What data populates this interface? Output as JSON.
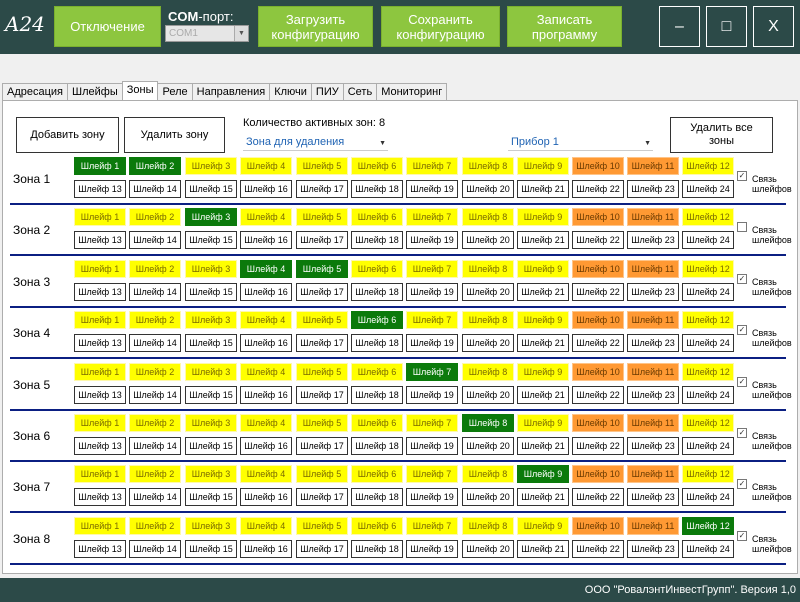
{
  "app": {
    "logo": "A24"
  },
  "toolbar": {
    "disconnect": "Отключение",
    "com_bold": "COM",
    "com_rest": "-порт:",
    "com_value": "COM1",
    "load": "Загрузить\nконфигурацию",
    "save": "Сохранить\nконфигурацию",
    "write": "Записать\nпрограмму",
    "minimize": "–",
    "maximize": "□",
    "close": "X"
  },
  "tabs": [
    "Адресация",
    "Шлейфы",
    "Зоны",
    "Реле",
    "Направления",
    "Ключи",
    "ПИУ",
    "Сеть",
    "Мониторинг"
  ],
  "active_tab": "Зоны",
  "zones_panel": {
    "add_button": "Добавить зону",
    "delete_button": "Удалить зону",
    "active_count": "Количество активных зон: 8",
    "zone_for_delete": "Зона для удаления",
    "device": "Прибор 1",
    "delete_all_button": "Удалить все\nзоны",
    "link_label": "Связь\nшлейфов"
  },
  "loops": [
    "Шлейф 1",
    "Шлейф 2",
    "Шлейф 3",
    "Шлейф 4",
    "Шлейф 5",
    "Шлейф 6",
    "Шлейф 7",
    "Шлейф 8",
    "Шлейф 9",
    "Шлейф 10",
    "Шлейф 11",
    "Шлейф 12",
    "Шлейф 13",
    "Шлейф 14",
    "Шлейф 15",
    "Шлейф 16",
    "Шлейф 17",
    "Шлейф 18",
    "Шлейф 19",
    "Шлейф 20",
    "Шлейф 21",
    "Шлейф 22",
    "Шлейф 23",
    "Шлейф 24"
  ],
  "zones": [
    {
      "name": "Зона 1",
      "selected": [
        1,
        2
      ],
      "link": true
    },
    {
      "name": "Зона 2",
      "selected": [
        3
      ],
      "link": false
    },
    {
      "name": "Зона 3",
      "selected": [
        4,
        5
      ],
      "link": true
    },
    {
      "name": "Зона 4",
      "selected": [
        6
      ],
      "link": true
    },
    {
      "name": "Зона 5",
      "selected": [
        7
      ],
      "link": true
    },
    {
      "name": "Зона 6",
      "selected": [
        8
      ],
      "link": true
    },
    {
      "name": "Зона 7",
      "selected": [
        9
      ],
      "link": true
    },
    {
      "name": "Зона 8",
      "selected": [
        12
      ],
      "link": true
    }
  ],
  "colors": {
    "topbar": "#2c4a48",
    "button_green": "#8dc63f",
    "loop_yellow": "#ffff00",
    "loop_orange": "#ff9933",
    "loop_selected": "#0b7a0b",
    "zone_line": "#0b1f82"
  },
  "footer": {
    "version": "ООО \"РовалэнтИнвестГрупп\". Версия 1,0"
  }
}
